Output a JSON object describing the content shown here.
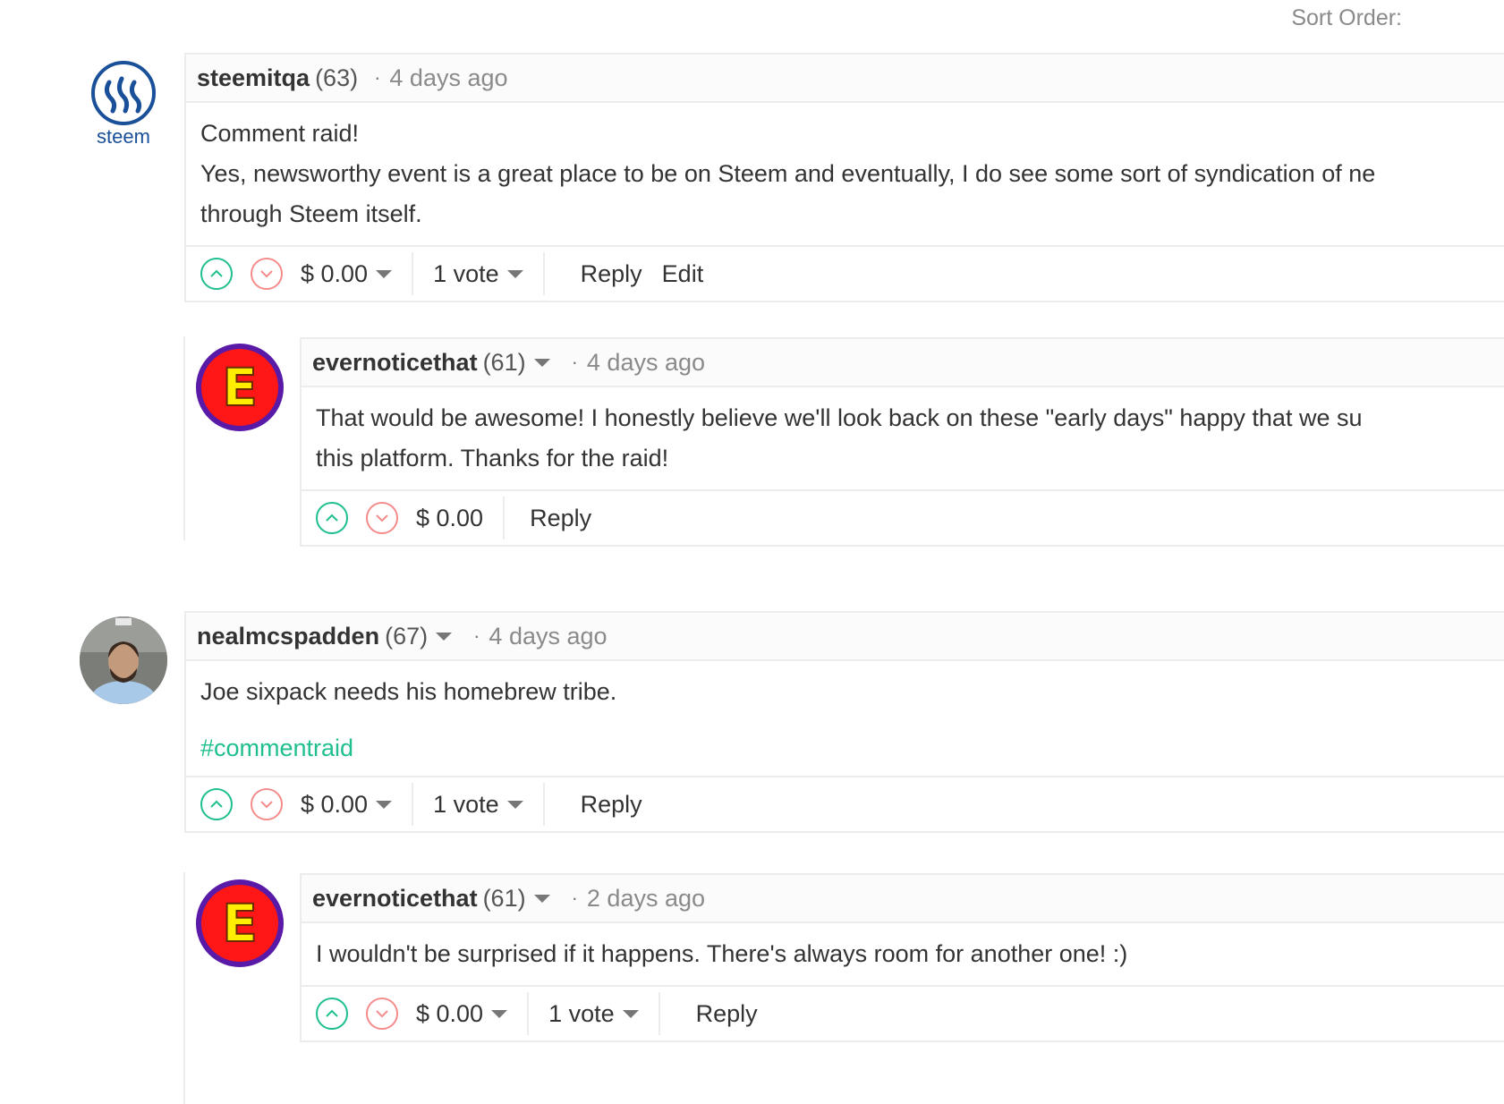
{
  "sort_label": "Sort Order:",
  "comments": [
    {
      "author": "steemitqa",
      "rep": "(63)",
      "dot": "·",
      "time": "4 days ago",
      "avatar_text": "steem",
      "body": [
        "Comment raid!",
        "Yes, newsworthy event is a great place to be on Steem and eventually, I do see some sort of syndication of ne",
        "through Steem itself."
      ],
      "payout": "$ 0.00",
      "votes": "1 vote",
      "actions": [
        "Reply",
        "Edit"
      ]
    },
    {
      "author": "evernoticethat",
      "rep": "(61)",
      "dot": "·",
      "time": "4 days ago",
      "avatar_text": "E",
      "body": [
        "That would be awesome! I honestly believe we'll look back on these \"early days\" happy that we su",
        "this platform. Thanks for the raid!"
      ],
      "payout": "$ 0.00",
      "actions": [
        "Reply"
      ]
    },
    {
      "author": "nealmcspadden",
      "rep": "(67)",
      "dot": "·",
      "time": "4 days ago",
      "body": [
        "Joe sixpack needs his homebrew tribe."
      ],
      "tag": "#commentraid",
      "payout": "$ 0.00",
      "votes": "1 vote",
      "actions": [
        "Reply"
      ]
    },
    {
      "author": "evernoticethat",
      "rep": "(61)",
      "dot": "·",
      "time": "2 days ago",
      "avatar_text": "E",
      "body": [
        "I wouldn't be surprised if it happens. There's always room for another one! :)"
      ],
      "payout": "$ 0.00",
      "votes": "1 vote",
      "actions": [
        "Reply"
      ]
    }
  ],
  "colors": {
    "upvote": "#1fbf8f",
    "downvote": "#f48c8c",
    "tag": "#1fbf8f",
    "steem_blue": "#1a5099"
  },
  "icons": [
    "steem-logo-icon",
    "upvote-chevron-icon",
    "downvote-chevron-icon",
    "dropdown-caret-icon"
  ]
}
